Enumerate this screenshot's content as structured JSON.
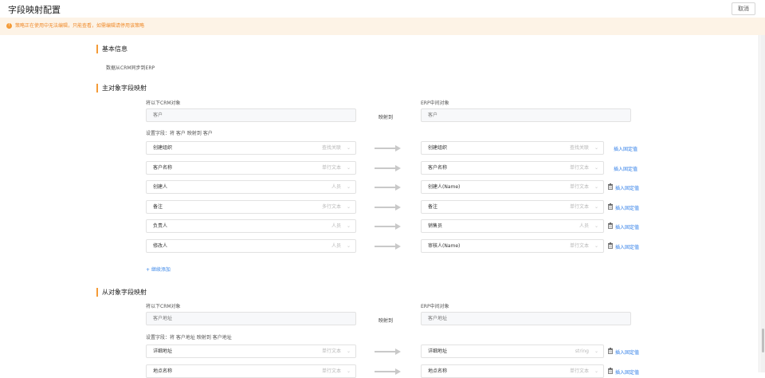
{
  "header": {
    "title": "字段映射配置",
    "cancel_label": "取消"
  },
  "warning": {
    "text": "策略正在使用中无法编辑，只能查看，如需编辑请停用该策略"
  },
  "basic": {
    "title": "基本信息",
    "description": "数据从CRM同步到ERP"
  },
  "main": {
    "title": "主对象字段映射",
    "source_label": "将以下CRM对象",
    "target_label": "ERP中间对象",
    "source_value": "客户",
    "target_value": "客户",
    "map_label": "映射到",
    "set_fields_label": "设置字段：将 客户 映射到 客户",
    "add_more": "+ 继续添加",
    "rows": [
      {
        "src": "创建组织",
        "src_type": "查找关联",
        "dst": "创建组织",
        "dst_type": "查找关联",
        "link": "插入固定值",
        "trash": false
      },
      {
        "src": "客户名称",
        "src_type": "单行文本",
        "dst": "客户名称",
        "dst_type": "单行文本",
        "link": "插入固定值",
        "trash": false
      },
      {
        "src": "创建人",
        "src_type": "人员",
        "dst": "创建人(Name)",
        "dst_type": "单行文本",
        "link": "插入固定值",
        "trash": true
      },
      {
        "src": "备注",
        "src_type": "多行文本",
        "dst": "备注",
        "dst_type": "单行文本",
        "link": "插入固定值",
        "trash": true
      },
      {
        "src": "负责人",
        "src_type": "人员",
        "dst": "销售员",
        "dst_type": "人员",
        "link": "插入固定值",
        "trash": true
      },
      {
        "src": "修改人",
        "src_type": "人员",
        "dst": "审核人(Name)",
        "dst_type": "单行文本",
        "link": "插入固定值",
        "trash": true
      }
    ]
  },
  "sub": {
    "title": "从对象字段映射",
    "source_label": "将以下CRM对象",
    "target_label": "ERP中间对象",
    "source_value": "客户地址",
    "target_value": "客户地址",
    "map_label": "映射到",
    "set_fields_label": "设置字段：将 客户地址 映射到 客户地址",
    "rows": [
      {
        "src": "详细地址",
        "src_type": "单行文本",
        "dst": "详细地址",
        "dst_type": "string",
        "link": "插入固定值",
        "trash": true
      },
      {
        "src": "地点名称",
        "src_type": "单行文本",
        "dst": "地点名称",
        "dst_type": "单行文本",
        "link": "插入固定值",
        "trash": true
      }
    ]
  },
  "colors": {
    "accent": "#f49b37",
    "link": "#2f7ee8",
    "warning_bg": "#fdf3e6"
  }
}
